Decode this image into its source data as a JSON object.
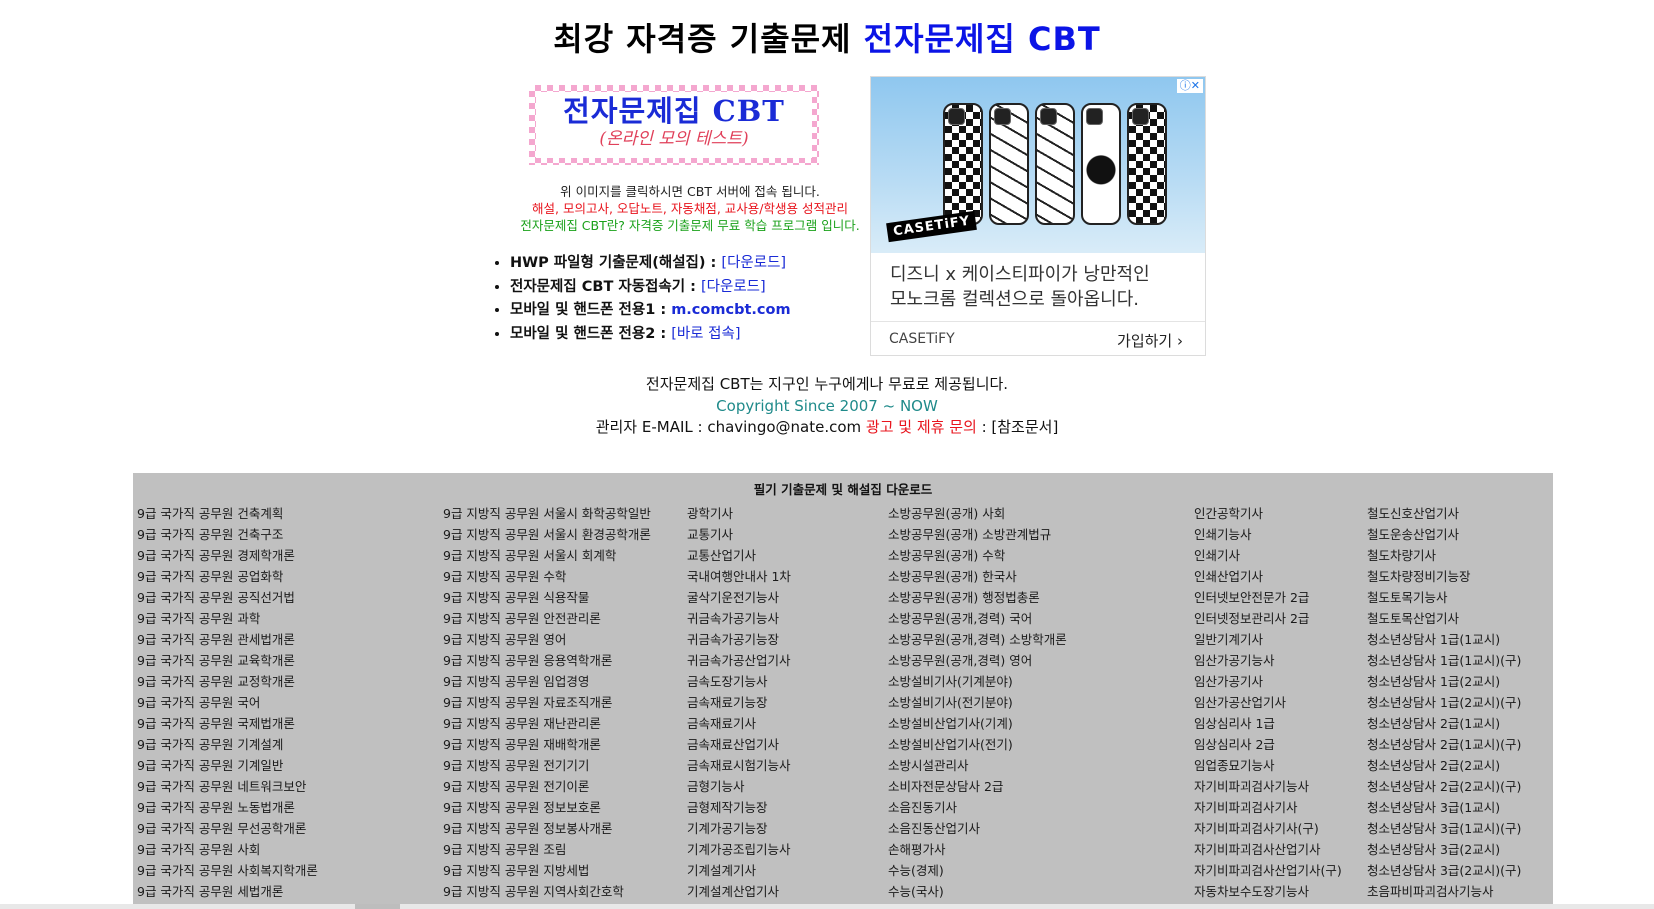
{
  "header": {
    "title_main": "최강 자격증 기출문제 ",
    "title_brand": "전자문제집 CBT"
  },
  "logo": {
    "title": "전자문제집 CBT",
    "subtitle": "(온라인 모의 테스트)"
  },
  "info": {
    "line1": "위 이미지를 클릭하시면 CBT 서버에 접속 됩니다.",
    "line2": "해설, 모의고사, 오답노트, 자동채점, 교사용/학생용 성적관리",
    "line3": "전자문제집 CBT란? 자격증 기출문제 무료 학습 프로그램 입니다."
  },
  "links": [
    {
      "label": "HWP 파일형 기출문제(해설집) : ",
      "link": "[다운로드]"
    },
    {
      "label": "전자문제집 CBT 자동접속기 : ",
      "link": "[다운로드]"
    },
    {
      "label": "모바일 및 핸드폰 전용1 : ",
      "link": "m.comcbt.com"
    },
    {
      "label": "모바일 및 핸드폰 전용2 : ",
      "link": "[바로 접속]"
    }
  ],
  "ad": {
    "badge": "ⓘ✕",
    "image_brand": "CASETiFY",
    "text_line1": "디즈니 x 케이스티파이가 낭만적인",
    "text_line2": "모노크롬 컬렉션으로 돌아옵니다.",
    "source": "CASETiFY",
    "cta": "가입하기 ›"
  },
  "footer": {
    "line1": "전자문제집 CBT는 지구인 누구에게나 무료로 제공됩니다.",
    "copyright": "Copyright Since 2007 ~ NOW",
    "contact_prefix": "관리자 E-MAIL : chavingo@nate.com ",
    "contact_red": "광고 및 제휴 문의",
    "contact_suffix": " : [참조문서]"
  },
  "panel": {
    "title": "필기 기출문제 및 해설집 다운로드",
    "columns": [
      [
        "9급 국가직 공무원 건축계획",
        "9급 국가직 공무원 건축구조",
        "9급 국가직 공무원 경제학개론",
        "9급 국가직 공무원 공업화학",
        "9급 국가직 공무원 공직선거법",
        "9급 국가직 공무원 과학",
        "9급 국가직 공무원 관세법개론",
        "9급 국가직 공무원 교육학개론",
        "9급 국가직 공무원 교정학개론",
        "9급 국가직 공무원 국어",
        "9급 국가직 공무원 국제법개론",
        "9급 국가직 공무원 기계설계",
        "9급 국가직 공무원 기계일반",
        "9급 국가직 공무원 네트워크보안",
        "9급 국가직 공무원 노동법개론",
        "9급 국가직 공무원 무선공학개론",
        "9급 국가직 공무원 사회",
        "9급 국가직 공무원 사회복지학개론",
        "9급 국가직 공무원 세법개론"
      ],
      [
        "9급 지방직 공무원 서울시 화학공학일반",
        "9급 지방직 공무원 서울시 환경공학개론",
        "9급 지방직 공무원 서울시 회계학",
        "9급 지방직 공무원 수학",
        "9급 지방직 공무원 식용작물",
        "9급 지방직 공무원 안전관리론",
        "9급 지방직 공무원 영어",
        "9급 지방직 공무원 응용역학개론",
        "9급 지방직 공무원 임업경영",
        "9급 지방직 공무원 자료조직개론",
        "9급 지방직 공무원 재난관리론",
        "9급 지방직 공무원 재배학개론",
        "9급 지방직 공무원 전기기기",
        "9급 지방직 공무원 전기이론",
        "9급 지방직 공무원 정보보호론",
        "9급 지방직 공무원 정보봉사개론",
        "9급 지방직 공무원 조림",
        "9급 지방직 공무원 지방세법",
        "9급 지방직 공무원 지역사회간호학"
      ],
      [
        "광학기사",
        "교통기사",
        "교통산업기사",
        "국내여행안내사 1차",
        "굴삭기운전기능사",
        "귀금속가공기능사",
        "귀금속가공기능장",
        "귀금속가공산업기사",
        "금속도장기능사",
        "금속재료기능장",
        "금속재료기사",
        "금속재료산업기사",
        "금속재료시험기능사",
        "금형기능사",
        "금형제작기능장",
        "기계가공기능장",
        "기계가공조립기능사",
        "기계설계기사",
        "기계설계산업기사"
      ],
      [
        "소방공무원(공개) 사회",
        "소방공무원(공개) 소방관계법규",
        "소방공무원(공개) 수학",
        "소방공무원(공개) 한국사",
        "소방공무원(공개) 행정법총론",
        "소방공무원(공개,경력) 국어",
        "소방공무원(공개,경력) 소방학개론",
        "소방공무원(공개,경력) 영어",
        "소방설비기사(기계분야)",
        "소방설비기사(전기분야)",
        "소방설비산업기사(기계)",
        "소방설비산업기사(전기)",
        "소방시설관리사",
        "소비자전문상담사 2급",
        "소음진동기사",
        "소음진동산업기사",
        "손해평가사",
        "수능(경제)",
        "수능(국사)"
      ],
      [
        "인간공학기사",
        "인쇄기능사",
        "인쇄기사",
        "인쇄산업기사",
        "인터넷보안전문가 2급",
        "인터넷정보관리사 2급",
        "일반기계기사",
        "임산가공기능사",
        "임산가공기사",
        "임산가공산업기사",
        "임상심리사 1급",
        "임상심리사 2급",
        "임업종묘기능사",
        "자기비파괴검사기능사",
        "자기비파괴검사기사",
        "자기비파괴검사기사(구)",
        "자기비파괴검사산업기사",
        "자기비파괴검사산업기사(구)",
        "자동차보수도장기능사"
      ],
      [
        "철도신호산업기사",
        "철도운송산업기사",
        "철도차량기사",
        "철도차량정비기능장",
        "철도토목기능사",
        "철도토목산업기사",
        "청소년상담사 1급(1교시)",
        "청소년상담사 1급(1교시)(구)",
        "청소년상담사 1급(2교시)",
        "청소년상담사 1급(2교시)(구)",
        "청소년상담사 2급(1교시)",
        "청소년상담사 2급(1교시)(구)",
        "청소년상담사 2급(2교시)",
        "청소년상담사 2급(2교시)(구)",
        "청소년상담사 3급(1교시)",
        "청소년상담사 3급(1교시)(구)",
        "청소년상담사 3급(2교시)",
        "청소년상담사 3급(2교시)(구)",
        "초음파비파괴검사기능사"
      ]
    ]
  }
}
